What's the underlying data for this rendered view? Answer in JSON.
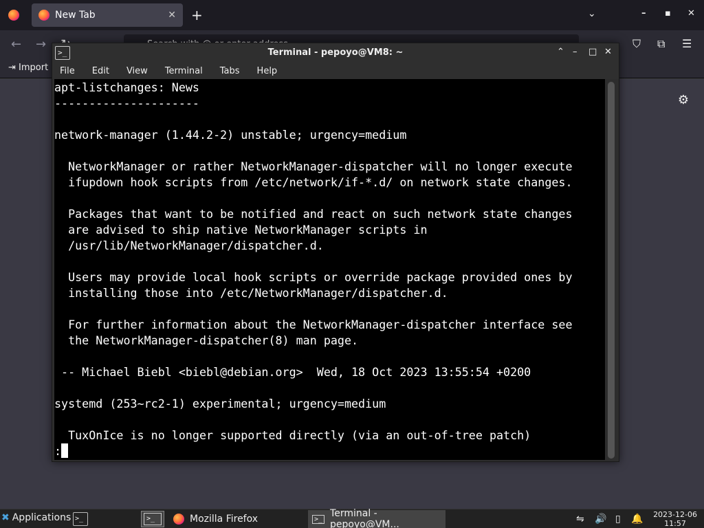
{
  "firefox": {
    "tab_title": "New Tab",
    "tab_close": "✕",
    "new_tab": "+",
    "list_all_tabs": "⌄",
    "win_min": "–",
    "win_max": "▪",
    "win_close": "✕",
    "back": "←",
    "forward": "→",
    "reload": "↻",
    "url_placeholder": "Search with @ or enter address",
    "bookmark_import": "Import",
    "pocket": "⛉",
    "extensions": "⧉",
    "menu": "☰",
    "settings_gear": "⚙"
  },
  "terminal": {
    "title": "Terminal - pepoyo@VM8: ~",
    "icon_glyph": ">_",
    "ctrl_up": "⌃",
    "ctrl_min": "–",
    "ctrl_max": "□",
    "ctrl_close": "✕",
    "menu": [
      "File",
      "Edit",
      "View",
      "Terminal",
      "Tabs",
      "Help"
    ],
    "lines": [
      "apt-listchanges: News",
      "---------------------",
      "",
      "network-manager (1.44.2-2) unstable; urgency=medium",
      "",
      "  NetworkManager or rather NetworkManager-dispatcher will no longer execute",
      "  ifupdown hook scripts from /etc/network/if-*.d/ on network state changes.",
      "",
      "  Packages that want to be notified and react on such network state changes",
      "  are advised to ship native NetworkManager scripts in",
      "  /usr/lib/NetworkManager/dispatcher.d.",
      "",
      "  Users may provide local hook scripts or override package provided ones by",
      "  installing those into /etc/NetworkManager/dispatcher.d.",
      "",
      "  For further information about the NetworkManager-dispatcher interface see",
      "  the NetworkManager-dispatcher(8) man page.",
      "",
      " -- Michael Biebl <biebl@debian.org>  Wed, 18 Oct 2023 13:55:54 +0200",
      "",
      "systemd (253~rc2-1) experimental; urgency=medium",
      "",
      "  TuxOnIce is no longer supported directly (via an out-of-tree patch)"
    ],
    "prompt": ":"
  },
  "taskbar": {
    "applications": "Applications",
    "term_launcher_glyph": ">_",
    "tasks": [
      {
        "label": "Mozilla Firefox",
        "icon": "firefox-icon"
      },
      {
        "label": "Terminal - pepoyo@VM...",
        "icon": "terminal-icon"
      }
    ],
    "tray": {
      "network": "⇋",
      "volume": "🔊",
      "power": "▯",
      "bell": "🔔"
    },
    "date": "2023-12-06",
    "time": "11:57"
  }
}
